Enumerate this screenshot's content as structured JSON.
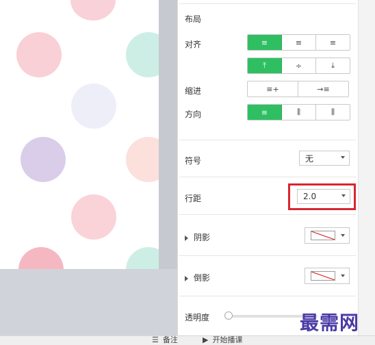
{
  "panel": {
    "layout_title": "布局",
    "align_label": "对齐",
    "indent_label": "缩进",
    "direction_label": "方向",
    "symbol_label": "符号",
    "symbol_value": "无",
    "line_spacing_label": "行距",
    "line_spacing_value": "2.0",
    "shadow_label": "阴影",
    "reflection_label": "倒影",
    "opacity_label": "透明度",
    "opacity_value": 0
  },
  "align_buttons_row1": [
    "≡",
    "≡",
    "≡"
  ],
  "align_buttons_row2": [
    "⤒",
    "÷",
    "⤓"
  ],
  "indent_buttons": [
    "≡+",
    "→≡"
  ],
  "direction_buttons": [
    "≡",
    "⫼",
    "⫼"
  ],
  "colors": {
    "accent": "#2fbf62",
    "highlight": "#d9252f",
    "watermark": "#4a3aa6"
  },
  "statusbar": {
    "notes": "备注",
    "start_show": "开始播课"
  },
  "watermark": "最需网"
}
